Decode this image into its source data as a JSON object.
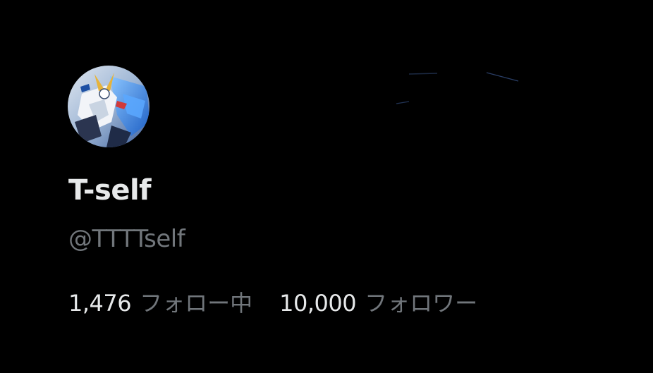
{
  "profile": {
    "display_name": "T-self",
    "handle": "@TTTTself",
    "avatar_icon": "robot-mecha-avatar-icon"
  },
  "stats": {
    "following_count": "1,476",
    "following_label": "フォロー中",
    "followers_count": "10,000",
    "followers_label": "フォロワー"
  },
  "colors": {
    "background": "#000000",
    "primary_text": "#e7e9ea",
    "secondary_text": "#71767b",
    "avatar_accent": "#4a90e2"
  }
}
